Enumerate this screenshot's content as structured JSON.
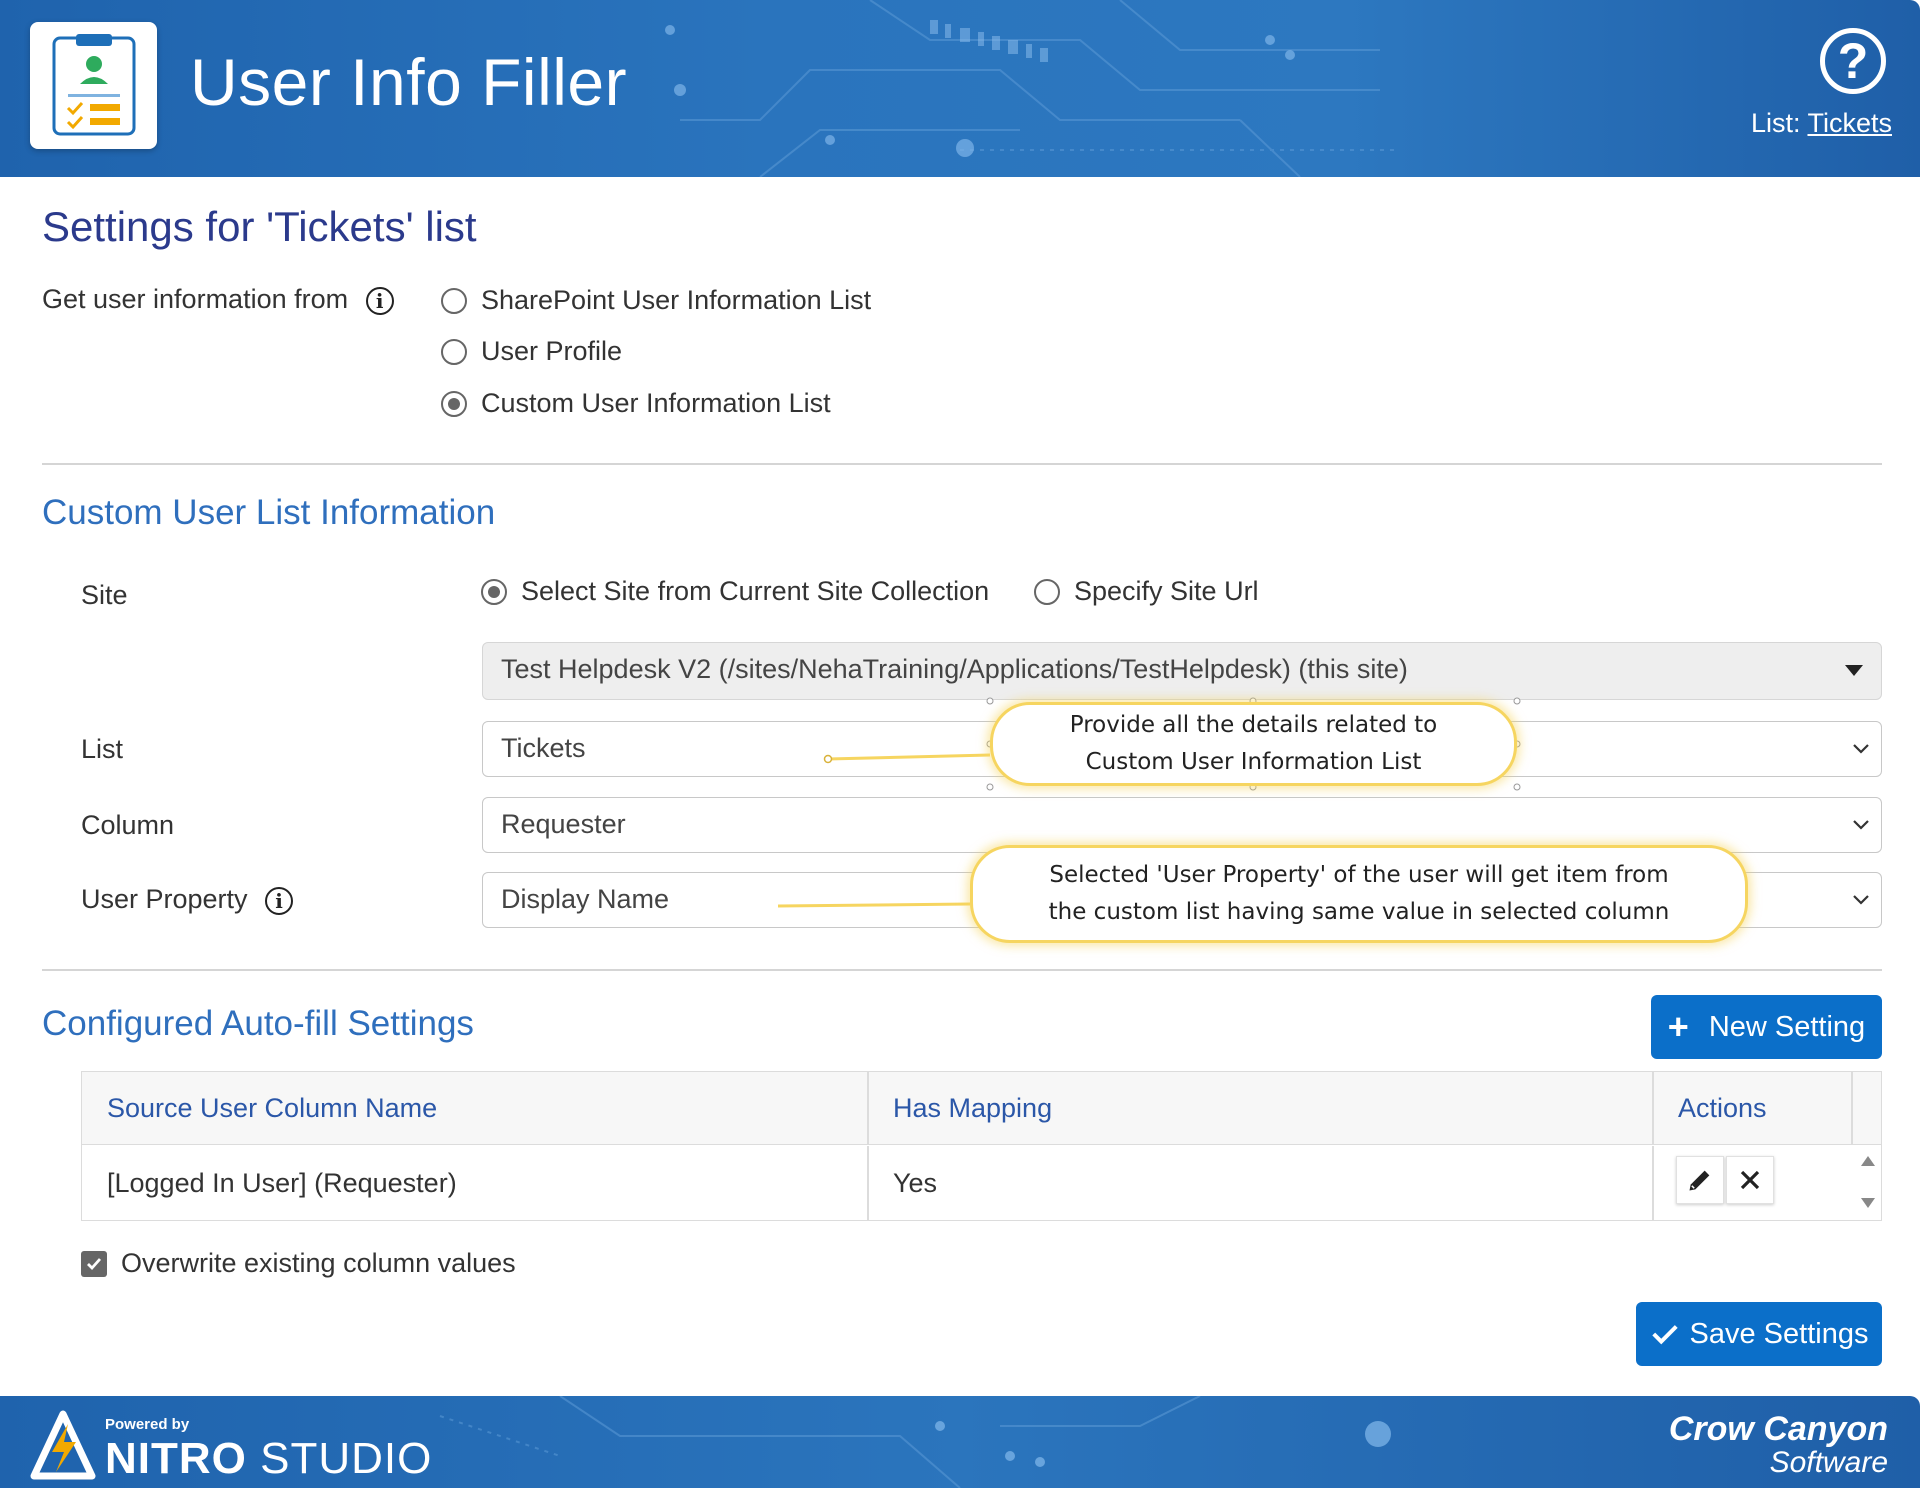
{
  "header": {
    "title": "User Info Filler",
    "help_icon": "question-circle-icon",
    "list_prefix": "List:",
    "list_link": "Tickets"
  },
  "page_title": "Settings for 'Tickets' list",
  "source": {
    "label": "Get user information from",
    "options": [
      {
        "label": "SharePoint User Information List",
        "checked": false
      },
      {
        "label": "User Profile",
        "checked": false
      },
      {
        "label": "Custom User Information List",
        "checked": true
      }
    ]
  },
  "custom_list": {
    "section_title": "Custom User List Information",
    "site_label": "Site",
    "site_options": [
      {
        "label": "Select Site from Current Site Collection",
        "checked": true
      },
      {
        "label": "Specify Site Url",
        "checked": false
      }
    ],
    "site_value": "Test Helpdesk V2 (/sites/NehaTraining/Applications/TestHelpdesk) (this site)",
    "list_label": "List",
    "list_value": "Tickets",
    "column_label": "Column",
    "column_value": "Requester",
    "property_label": "User Property",
    "property_value": "Display Name"
  },
  "callouts": {
    "first_line1": "Provide all the details related to",
    "first_line2": "Custom User Information List",
    "second_line1": "Selected 'User Property' of the user will get item from",
    "second_line2": "the custom list having same value in selected column"
  },
  "autofill": {
    "section_title": "Configured Auto-fill Settings",
    "new_button": "New Setting",
    "columns": [
      "Source User Column Name",
      "Has Mapping",
      "Actions"
    ],
    "rows": [
      {
        "source": "[Logged In User] (Requester)",
        "mapping": "Yes"
      }
    ],
    "overwrite_label": "Overwrite existing column values",
    "overwrite_checked": true,
    "save_button": "Save Settings"
  },
  "footer": {
    "powered_by": "Powered by",
    "nitro": "NITRO",
    "studio": "STUDIO",
    "brand_line1": "Crow Canyon",
    "brand_line2": "Software"
  },
  "colors": {
    "header_blue": "#2a74bd",
    "title_navy": "#2b3a8c",
    "section_blue": "#2f6fbd",
    "button_blue": "#0b6fc9",
    "callout_border": "#f6d560"
  }
}
